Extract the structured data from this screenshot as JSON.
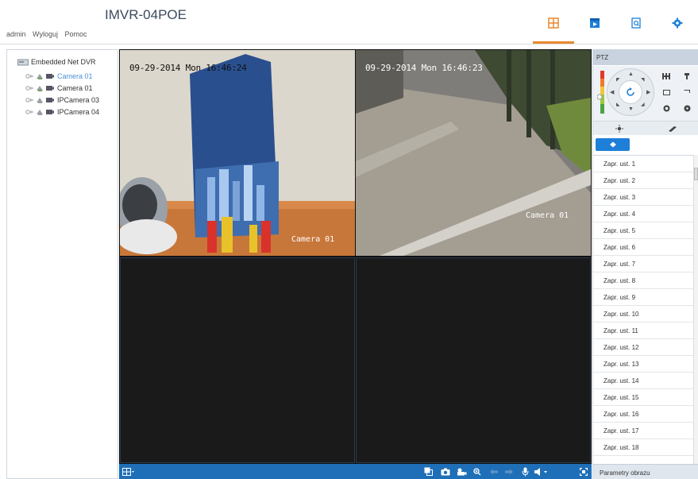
{
  "header": {
    "title": "IMVR-04POE",
    "user": "admin",
    "logout": "Wyloguj",
    "help": "Pomoc"
  },
  "colors": {
    "accent_orange": "#e8892f",
    "accent_blue": "#1e7fd8",
    "toolbar_blue": "#1f6fb8",
    "selected_text": "#4a8fd6"
  },
  "tree": {
    "root": "Embedded Net DVR",
    "items": [
      {
        "label": "Camera 01",
        "selected": true
      },
      {
        "label": "Camera 01",
        "selected": false
      },
      {
        "label": "IPCamera 03",
        "selected": false
      },
      {
        "label": "IPCamera 04",
        "selected": false
      }
    ]
  },
  "video": {
    "cells": [
      {
        "time": "09-29-2014 Mon 16:46:24",
        "camera": "Camera 01"
      },
      {
        "time": "09-29-2014 Mon 16:46:23",
        "camera": "Camera 01"
      }
    ]
  },
  "ptz": {
    "title": "PTZ",
    "presets": [
      "Zapr. ust. 1",
      "Zapr. ust. 2",
      "Zapr. ust. 3",
      "Zapr. ust. 4",
      "Zapr. ust. 5",
      "Zapr. ust. 6",
      "Zapr. ust. 7",
      "Zapr. ust. 8",
      "Zapr. ust. 9",
      "Zapr. ust. 10",
      "Zapr. ust. 11",
      "Zapr. ust. 12",
      "Zapr. ust. 13",
      "Zapr. ust. 14",
      "Zapr. ust. 15",
      "Zapr. ust. 16",
      "Zapr. ust. 17",
      "Zapr. ust. 18"
    ],
    "bottom_tab": "Parametry obrazu"
  }
}
